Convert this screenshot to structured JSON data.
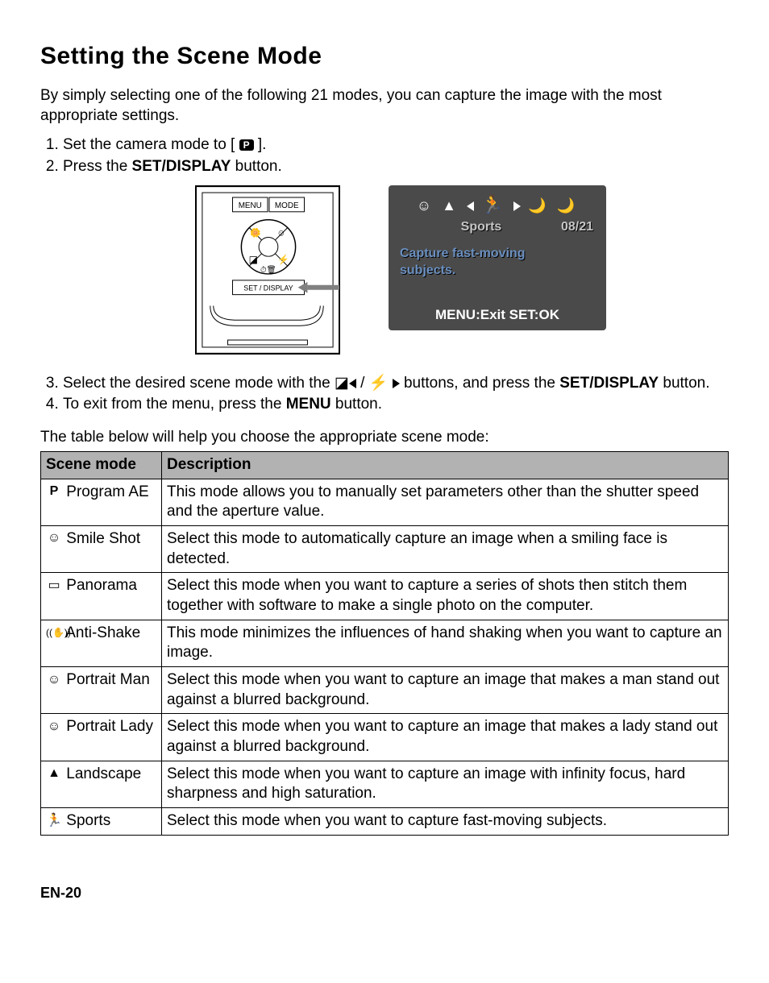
{
  "title": "Setting the Scene Mode",
  "intro": "By simply selecting one of the following 21 modes, you can capture the image with the most  appropriate settings.",
  "step1_a": "Set the camera mode to [ ",
  "step1_b": " ].",
  "step2_a": "Press the ",
  "step2_b": "SET/DISPLAY",
  "step2_c": " button.",
  "screen": {
    "mode_label": "Sports",
    "counter": "08/21",
    "desc_line1": "Capture fast-moving",
    "desc_line2": "subjects.",
    "footer": "MENU:Exit  SET:OK"
  },
  "camera_buttons": {
    "menu": "MENU",
    "mode": "MODE",
    "set": "SET / DISPLAY"
  },
  "step3_a": "Select the desired scene mode with the ",
  "step3_b": " buttons, and press the ",
  "step3_c": "SET/DISPLAY",
  "step3_d": " button.",
  "step4_a": "To exit from the menu, press the ",
  "step4_b": "MENU",
  "step4_c": " button.",
  "table_intro": "The table below will help you choose the appropriate scene mode:",
  "table": {
    "head_mode": "Scene mode",
    "head_desc": "Description",
    "rows": [
      {
        "sym": "P",
        "name": "Program AE",
        "desc": "This mode allows you to manually set parameters other than the shutter speed and the aperture value."
      },
      {
        "sym": "☺",
        "name": "Smile Shot",
        "desc": "Select this mode to automatically capture an image when a smiling face is detected."
      },
      {
        "sym": "▭",
        "name": "Panorama",
        "desc": "Select this mode when you want to capture a series of shots then stitch them together with software to make a single photo on the computer."
      },
      {
        "sym": "((✋))",
        "name": "Anti-Shake",
        "desc": "This mode minimizes the influences of hand shaking when you want to capture an image."
      },
      {
        "sym": "☺",
        "name": "Portrait Man",
        "desc": "Select this mode when you want to capture an image that makes a man stand out against a blurred background."
      },
      {
        "sym": "☺",
        "name": "Portrait Lady",
        "desc": "Select this mode when you want to capture an image that makes a lady stand out against a blurred background."
      },
      {
        "sym": "▲",
        "name": "Landscape",
        "desc": "Select this mode when you want to capture an image with infinity focus, hard sharpness and high saturation."
      },
      {
        "sym": "🏃",
        "name": "Sports",
        "desc": "Select this mode when you want to capture fast-moving subjects."
      }
    ]
  },
  "page_num": "EN-20"
}
